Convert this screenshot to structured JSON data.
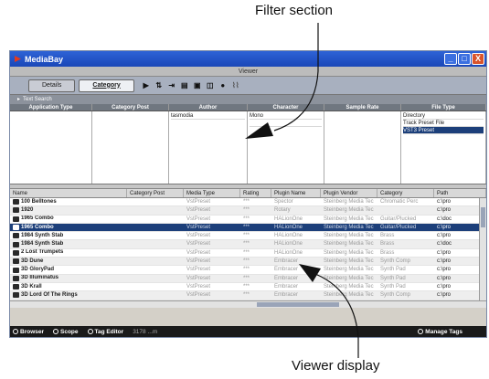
{
  "callouts": {
    "filter": "Filter section",
    "viewer": "Viewer display"
  },
  "window": {
    "title": "MediaBay",
    "subtitle": "Viewer",
    "controls": {
      "minimize": "_",
      "maximize": "□",
      "close": "X"
    }
  },
  "toolbar": {
    "tabs": [
      {
        "label": "Details",
        "active": false
      },
      {
        "label": "Category",
        "active": true
      }
    ],
    "icons": [
      "play-icon",
      "filter-icon",
      "sort-icon",
      "list-icon",
      "folder-icon",
      "grid-icon",
      "sphere-icon",
      "waveform-icon"
    ]
  },
  "filter": {
    "section_title": "Text Search",
    "columns": [
      "Application Type",
      "Category Post",
      "Author",
      "Character",
      "Sample Rate",
      "File Type"
    ],
    "author_values": [
      "tasmodia"
    ],
    "character_values": [
      "Mono"
    ],
    "file_type_values": [
      "Directory",
      "Track Preset File",
      "VST3 Preset"
    ],
    "selected_file_type": "VST3 Preset"
  },
  "viewer": {
    "columns": [
      "Name",
      "Category Post",
      "Media Type",
      "Rating",
      "Plugin Name",
      "Plugin Vendor",
      "Category",
      "Path"
    ],
    "rows": [
      {
        "name": "100 Belltones",
        "category_post": "",
        "media_type": "VstPreset",
        "rating": "***",
        "plugin": "Spector",
        "vendor": "Steinberg Media Tec",
        "category": "Chromatic Perc",
        "path": "c:\\pro"
      },
      {
        "name": "1920",
        "category_post": "",
        "media_type": "VstPreset",
        "rating": "***",
        "plugin": "Rotary",
        "vendor": "Steinberg Media Tec",
        "category": "",
        "path": "c:\\pro"
      },
      {
        "name": "1965 Combo",
        "category_post": "",
        "media_type": "VstPreset",
        "rating": "***",
        "plugin": "HALionOne",
        "vendor": "Steinberg Media Tec",
        "category": "Guitar/Plucked",
        "path": "c:\\doc"
      },
      {
        "name": "1965 Combo",
        "category_post": "",
        "media_type": "VstPreset",
        "rating": "***",
        "plugin": "HALionOne",
        "vendor": "Steinberg Media Tec",
        "category": "Guitar/Plucked",
        "path": "c:\\pro",
        "selected": true
      },
      {
        "name": "1984 Synth Stab",
        "category_post": "",
        "media_type": "VstPreset",
        "rating": "***",
        "plugin": "HALionOne",
        "vendor": "Steinberg Media Tec",
        "category": "Brass",
        "path": "c:\\pro"
      },
      {
        "name": "1984 Synth Stab",
        "category_post": "",
        "media_type": "VstPreset",
        "rating": "***",
        "plugin": "HALionOne",
        "vendor": "Steinberg Media Tec",
        "category": "Brass",
        "path": "c:\\doc"
      },
      {
        "name": "2 Lost Trumpets",
        "category_post": "",
        "media_type": "VstPreset",
        "rating": "***",
        "plugin": "HALionOne",
        "vendor": "Steinberg Media Tec",
        "category": "Brass",
        "path": "c:\\pro"
      },
      {
        "name": "3D Dune",
        "category_post": "",
        "media_type": "VstPreset",
        "rating": "***",
        "plugin": "Embracer",
        "vendor": "Steinberg Media Tec",
        "category": "Synth Comp",
        "path": "c:\\pro"
      },
      {
        "name": "3D GloryPad",
        "category_post": "",
        "media_type": "VstPreset",
        "rating": "***",
        "plugin": "Embracer",
        "vendor": "Steinberg Media Tec",
        "category": "Synth Pad",
        "path": "c:\\pro"
      },
      {
        "name": "3D Illuminatus",
        "category_post": "",
        "media_type": "VstPreset",
        "rating": "***",
        "plugin": "Embracer",
        "vendor": "Steinberg Media Tec",
        "category": "Synth Pad",
        "path": "c:\\pro"
      },
      {
        "name": "3D Krall",
        "category_post": "",
        "media_type": "VstPreset",
        "rating": "***",
        "plugin": "Embracer",
        "vendor": "Steinberg Media Tec",
        "category": "Synth Pad",
        "path": "c:\\pro"
      },
      {
        "name": "3D Lord Of The Rings",
        "category_post": "",
        "media_type": "VstPreset",
        "rating": "***",
        "plugin": "Embracer",
        "vendor": "Steinberg Media Tec",
        "category": "Synth Comp",
        "path": "c:\\pro"
      }
    ]
  },
  "status": {
    "browser": "Browser",
    "scope": "Scope",
    "tag_editor": "Tag Editor",
    "count": "3178 ...m",
    "manage_tags": "Manage Tags"
  }
}
